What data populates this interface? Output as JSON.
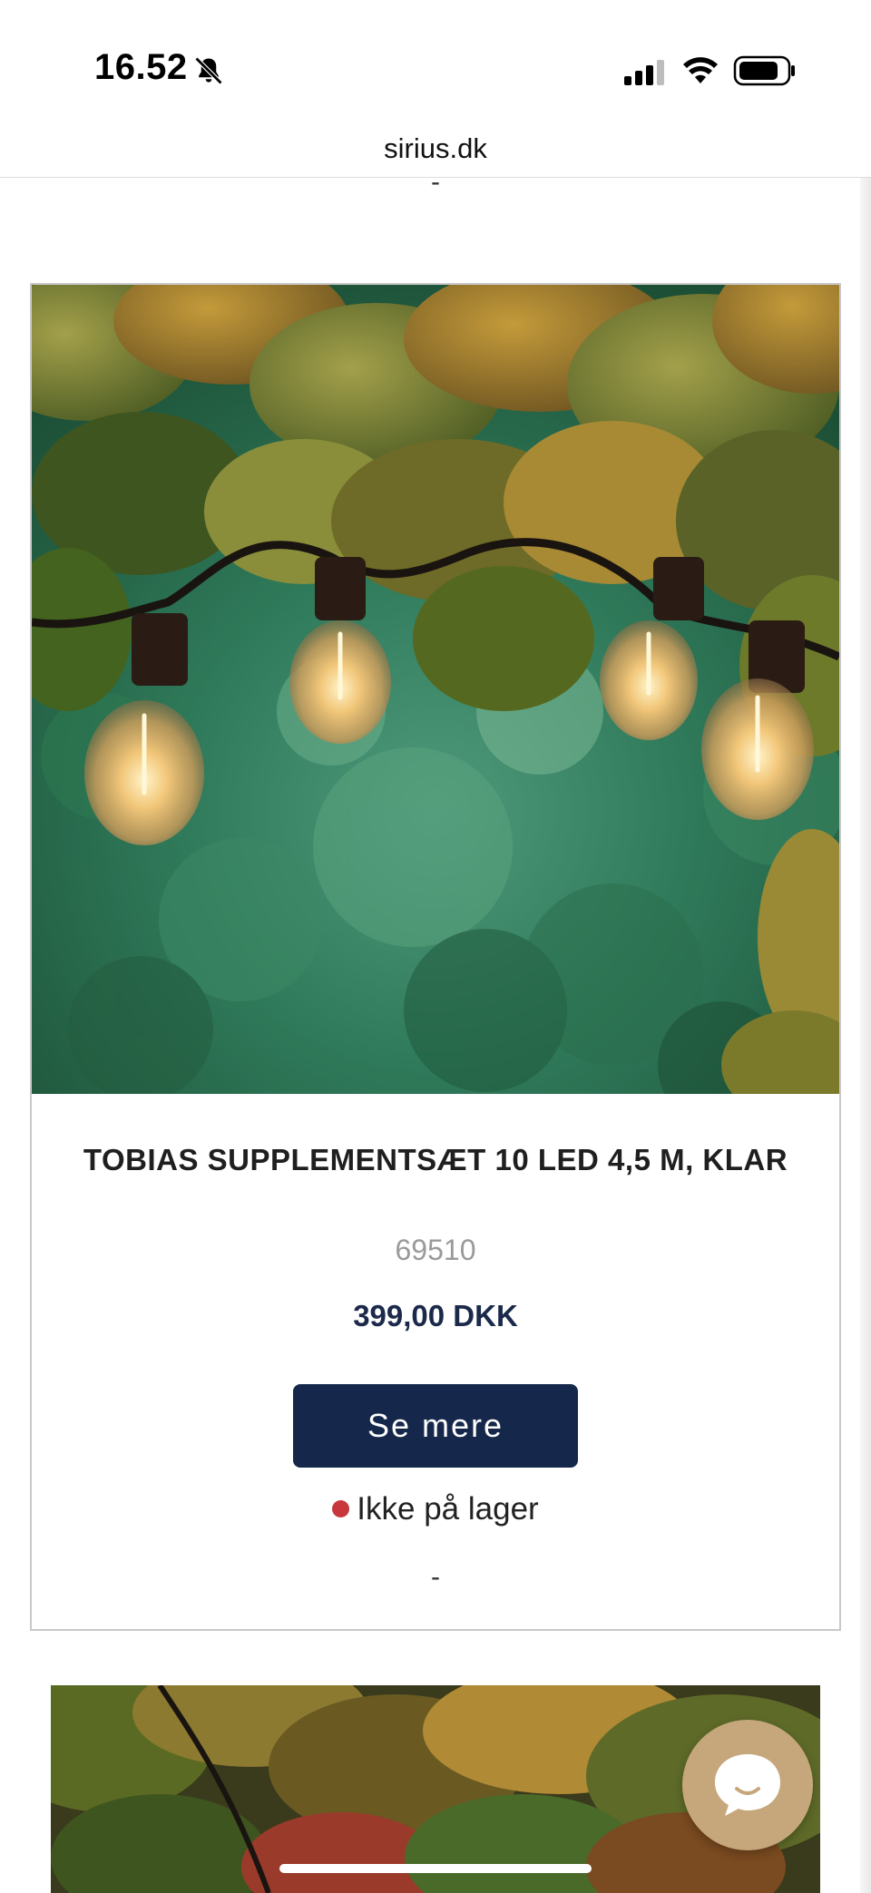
{
  "status_bar": {
    "time": "16.52",
    "icons": [
      "bell-muted-icon",
      "signal-icon",
      "wifi-icon",
      "battery-icon"
    ]
  },
  "browser": {
    "url": "sirius.dk"
  },
  "page": {
    "top_separator": "-",
    "product": {
      "image_icon": "product-photo-string-lights",
      "title": "TOBIAS SUPPLEMENTSÆT 10 LED 4,5 M, KLAR",
      "sku": "69510",
      "price": "399,00 DKK",
      "see_more_label": "Se mere",
      "stock_status": "Ikke på lager",
      "stock_color": "#c8383b",
      "bottom_separator": "-"
    },
    "next_product": {
      "image_icon": "product-photo-foliage"
    }
  },
  "chat": {
    "icon": "chat-bubble-icon",
    "color": "#c6a77c"
  },
  "colors": {
    "button_bg": "#15284b",
    "price_text": "#1b2a4a"
  }
}
